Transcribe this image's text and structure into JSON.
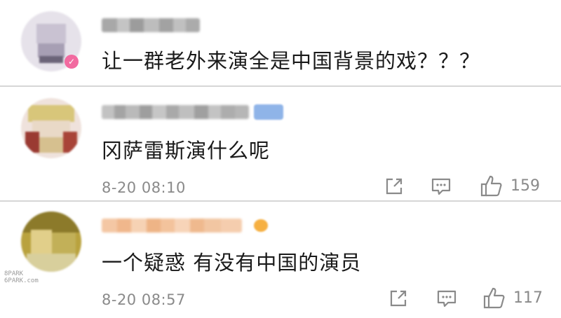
{
  "comments": [
    {
      "username": "",
      "text": "让一群老外来演全是中国背景的戏？？？",
      "badge": "✓",
      "timestamp": "",
      "share_icon": "share-icon",
      "reply_icon": "comment-icon",
      "like_icon": "thumbs-up-icon",
      "like_count": ""
    },
    {
      "username": "",
      "text": "冈萨雷斯演什么呢",
      "timestamp": "8-20 08:10",
      "like_count": "159"
    },
    {
      "username": "",
      "text": "一个疑惑 有没有中国的演员",
      "timestamp": "8-20 08:57",
      "like_count": "117"
    }
  ],
  "watermark": {
    "line1": "8PARK",
    "line2": "6PARK.com"
  },
  "colors": {
    "text": "#1a1a1a",
    "meta": "#8a8a8a",
    "divider": "#d6d6d6",
    "badge": "#f26aa0"
  }
}
